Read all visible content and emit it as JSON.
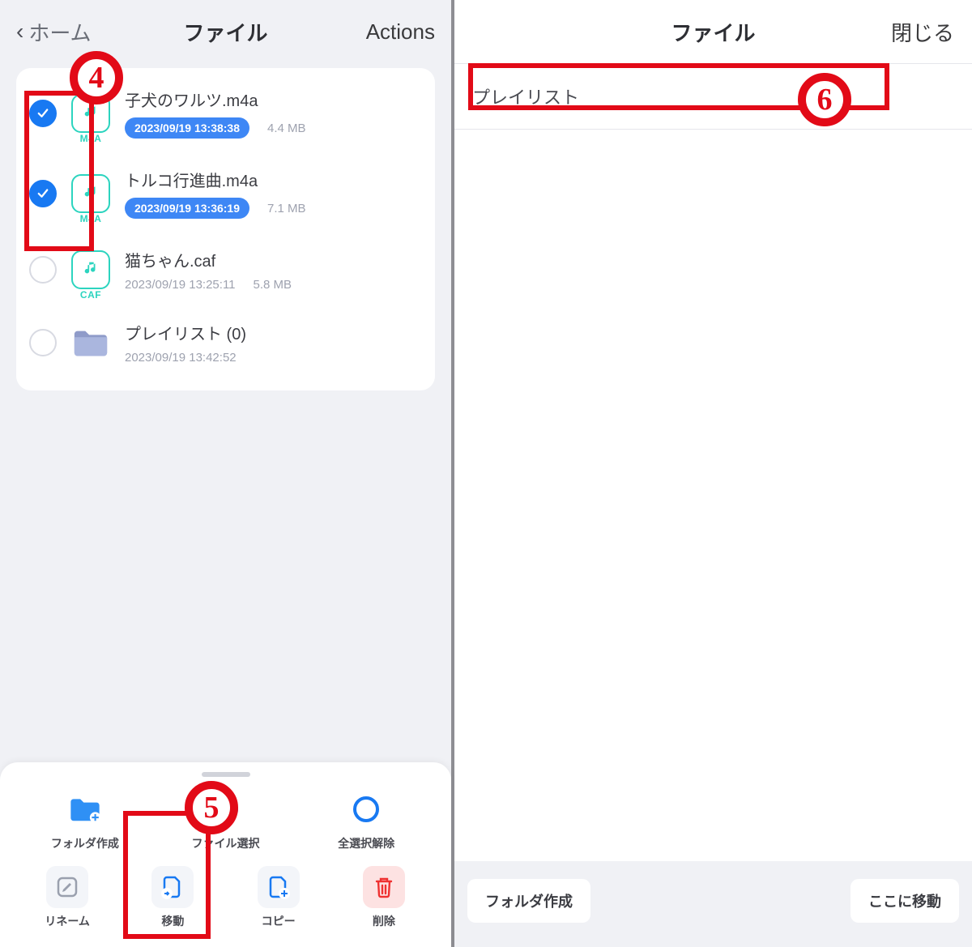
{
  "left": {
    "back_label": "ホーム",
    "title": "ファイル",
    "actions_label": "Actions",
    "files": [
      {
        "name": "子犬のワルツ.m4a",
        "timestamp": "2023/09/19 13:38:38",
        "size": "4.4 MB",
        "ext": "M4A",
        "selected": true,
        "pill": true,
        "kind": "audio"
      },
      {
        "name": "トルコ行進曲.m4a",
        "timestamp": "2023/09/19 13:36:19",
        "size": "7.1 MB",
        "ext": "M4A",
        "selected": true,
        "pill": true,
        "kind": "audio"
      },
      {
        "name": "猫ちゃん.caf",
        "timestamp": "2023/09/19 13:25:11",
        "size": "5.8 MB",
        "ext": "CAF",
        "selected": false,
        "pill": false,
        "kind": "audio"
      },
      {
        "name": "プレイリスト (0)",
        "timestamp": "2023/09/19 13:42:52",
        "size": "",
        "ext": "",
        "selected": false,
        "pill": false,
        "kind": "folder"
      }
    ],
    "sheet": {
      "row1": [
        {
          "label": "フォルダ作成",
          "icon": "folder-plus"
        },
        {
          "label": "ファイル選択",
          "icon": "check-circle"
        },
        {
          "label": "全選択解除",
          "icon": "circle-outline"
        }
      ],
      "row2": [
        {
          "label": "リネーム",
          "icon": "edit"
        },
        {
          "label": "移動",
          "icon": "file-move"
        },
        {
          "label": "コピー",
          "icon": "file-copy"
        },
        {
          "label": "削除",
          "icon": "trash"
        }
      ]
    }
  },
  "right": {
    "title": "ファイル",
    "close_label": "閉じる",
    "list_label": "プレイリスト",
    "footer_left": "フォルダ作成",
    "footer_right": "ここに移動"
  },
  "annotations": {
    "n4": "4",
    "n5": "5",
    "n6": "6"
  }
}
